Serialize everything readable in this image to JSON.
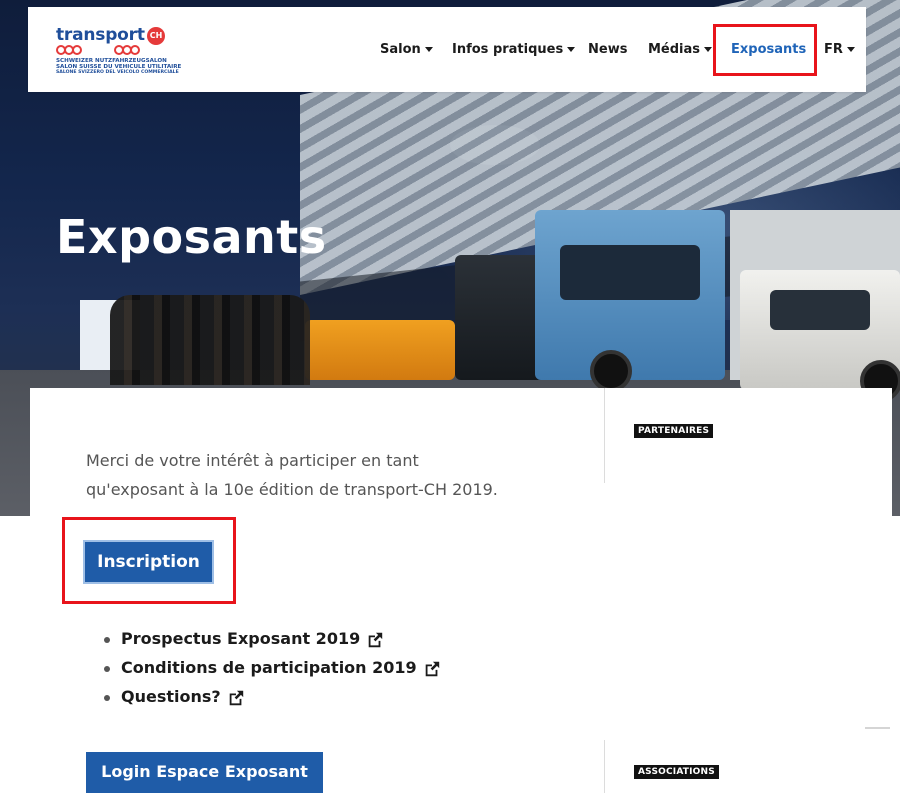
{
  "logo": {
    "name": "transport",
    "ch": "CH",
    "lines": [
      "SCHWEIZER NUTZFAHRZEUGSALON",
      "SALON SUISSE DU VEHICULE UTILITAIRE",
      "SALONE SVIZZERO DEL VEICOLO COMMERCIALE"
    ]
  },
  "nav": {
    "salon": "Salon",
    "infos": "Infos pratiques",
    "news": "News",
    "medias": "Médias",
    "exposants": "Exposants",
    "lang": "FR"
  },
  "hero": {
    "title": "Exposants"
  },
  "main": {
    "intro_line1": "Merci de votre intérêt à participer en tant",
    "intro_line2": "qu'exposant à la 10e édition de transport-CH 2019.",
    "inscription_label": "Inscription",
    "links": [
      "Prospectus Exposant 2019",
      "Conditions de participation 2019",
      "Questions?"
    ],
    "login_label": "Login Espace Exposant"
  },
  "sidebar": {
    "partenaires": "PARTENAIRES",
    "associations": "ASSOCIATIONS"
  },
  "colors": {
    "brand_blue": "#1f5ca8",
    "highlight_red": "#e8141b",
    "active_nav": "#1f64b8"
  },
  "icons": [
    "external-link-icon",
    "caret-down-icon"
  ]
}
